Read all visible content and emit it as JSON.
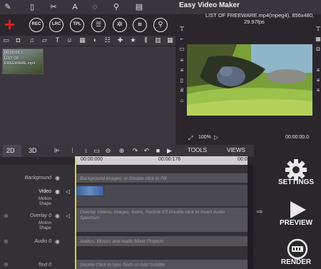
{
  "app": {
    "title": "Easy Video Maker"
  },
  "topbar": {
    "icons": [
      "logo-icon",
      "file-icon",
      "scissors-icon",
      "text-icon",
      "balloon-icon",
      "pen-icon",
      "video-clip-icon"
    ]
  },
  "toolrow": {
    "add_label": "+",
    "rec_label": "REC",
    "lrc_label": "LRC",
    "tpl_label": "TPL",
    "list_label": "☰",
    "effects_label": "✲",
    "grid_label": "⌗",
    "search_label": "⚲"
  },
  "media_bin": {
    "items": [
      {
        "time": "00:00:08.3",
        "name": "LIST OF",
        "name2": "FREEWARE.mp4"
      }
    ]
  },
  "preview": {
    "info_line1": "LIST OF FREEWARE.mp4(mpeg4), 856x480,",
    "info_line2": "29.97fps",
    "zoom": "100%",
    "timecode": "00:00:00.0"
  },
  "tabs": {
    "tab_2d": "2D",
    "tab_3d": "3D",
    "tools": "TOOLS",
    "views": "VIEWS"
  },
  "timeline": {
    "ruler_start": "00:00:000",
    "ruler_mid": "00:00:176",
    "ruler_end": "00:0",
    "tracks": [
      {
        "label": "Background",
        "hint": "Background Images, or Double click to Fill"
      },
      {
        "label": "Video",
        "sub1": "Motion",
        "sub2": "Shape",
        "hint": ""
      },
      {
        "label": "Overlay 0",
        "sub1": "Motion",
        "sub2": "Shape",
        "hint": "Overlay Videos, Images, Icons, Particle Eff Double click to Insert Audio",
        "hint2": "Spectrum"
      },
      {
        "label": "Audio 0",
        "hint": "Audios, Musics and Audio Mixer Projects"
      },
      {
        "label": "Text 0",
        "hint": "Double Click to type Texts or Add Subtitle"
      }
    ]
  },
  "right_panel": {
    "settings": "SETTINGS",
    "preview": "PREVIEW",
    "render": "RENDER"
  }
}
